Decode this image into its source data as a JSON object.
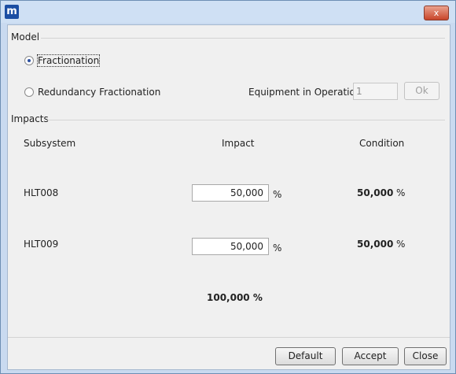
{
  "app_icon_letter": "m",
  "titlebar": {
    "close_glyph": "x"
  },
  "model": {
    "section_label": "Model",
    "fractionation_label": "Fractionation",
    "redundancy_label": "Redundancy Fractionation",
    "selected": "Fractionation",
    "equipment_label": "Equipment in Operation",
    "equipment_value": "1",
    "ok_label": "Ok"
  },
  "impacts": {
    "section_label": "Impacts",
    "col_subsystem": "Subsystem",
    "col_impact": "Impact",
    "col_condition": "Condition",
    "rows": [
      {
        "subsystem": "HLT008",
        "impact_value": "50,000",
        "impact_unit": "%",
        "condition_value": "50,000",
        "condition_unit": "%"
      },
      {
        "subsystem": "HLT009",
        "impact_value": "50,000",
        "impact_unit": "%",
        "condition_value": "50,000",
        "condition_unit": "%"
      }
    ],
    "total": "100,000 %"
  },
  "buttons": {
    "default": "Default",
    "accept": "Accept",
    "close": "Close"
  },
  "colors": {
    "titlebar": "#cfe0f4",
    "app_icon": "#1b4ea3",
    "close_button": "#c8452a",
    "radio_selected": "#2a4f9f"
  },
  "icons": {
    "app": "app-icon",
    "close": "close-icon"
  }
}
